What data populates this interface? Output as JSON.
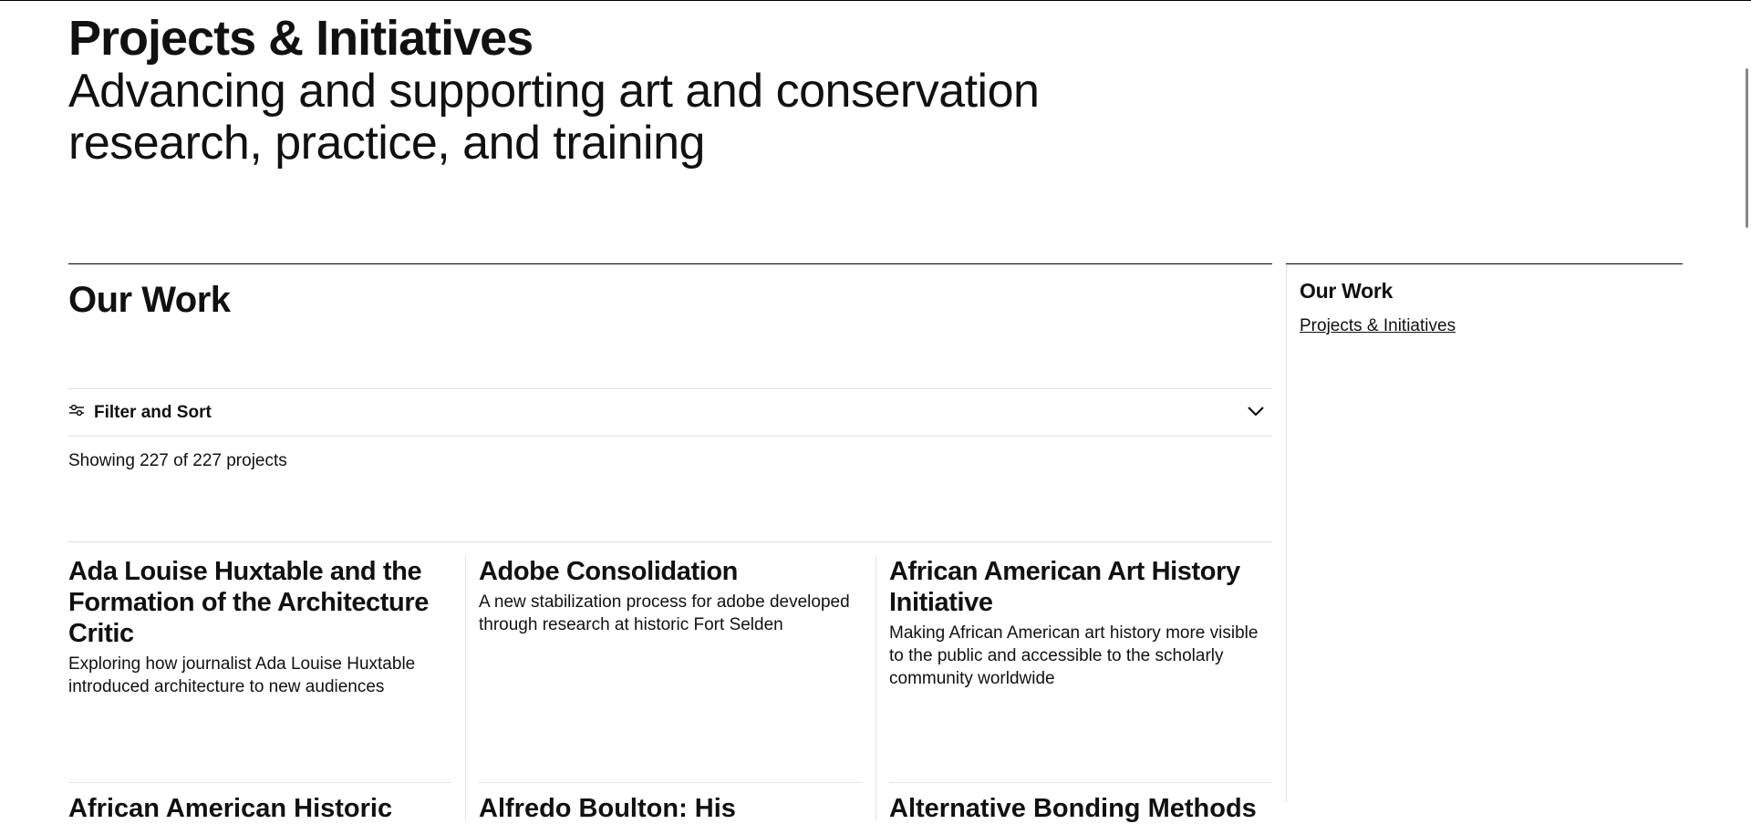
{
  "hero": {
    "title": "Projects & Initiatives",
    "subtitle": "Advancing and supporting art and conservation research, practice, and training"
  },
  "main": {
    "heading": "Our Work",
    "filter_label": "Filter and Sort",
    "count_text": "Showing 227 of 227 projects",
    "icons": {
      "filter": "sliders-icon",
      "expand": "chevron-down-icon"
    }
  },
  "cards": [
    {
      "title": "Ada Louise Huxtable and the Formation of the Architecture Critic",
      "description": "Exploring how journalist Ada Louise Huxtable introduced architecture to new audiences"
    },
    {
      "title": "Adobe Consolidation",
      "description": "A new stabilization process for adobe developed through research at historic Fort Selden"
    },
    {
      "title": "African American Art History Initiative",
      "description": "Making African American art history more visible to the public and accessible to the scholarly community worldwide"
    }
  ],
  "next_row_titles": [
    "African American Historic",
    "Alfredo Boulton: His",
    "Alternative Bonding Methods"
  ],
  "aside": {
    "heading": "Our Work",
    "link": "Projects & Initiatives"
  }
}
